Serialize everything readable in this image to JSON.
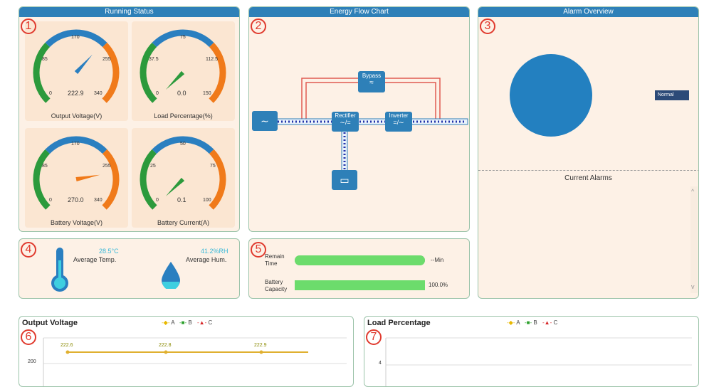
{
  "running_status": {
    "title": "Running Status",
    "badge": "1",
    "gauges": [
      {
        "label": "Output Voltage(V)",
        "value": "222.9",
        "min": "0",
        "tick1": "85",
        "tick2": "170",
        "tick3": "255",
        "max": "340",
        "fraction": 0.656
      },
      {
        "label": "Load Percentage(%)",
        "value": "0.0",
        "min": "0",
        "tick1": "37.5",
        "tick2": "75",
        "tick3": "112.5",
        "max": "150",
        "fraction": 0.0
      },
      {
        "label": "Battery Voltage(V)",
        "value": "270.0",
        "min": "0",
        "tick1": "85",
        "tick2": "170",
        "tick3": "255",
        "max": "340",
        "fraction": 0.794
      },
      {
        "label": "Battery Current(A)",
        "value": "0.1",
        "min": "0",
        "tick1": "25",
        "tick2": "50",
        "tick3": "75",
        "max": "100",
        "fraction": 0.001
      }
    ]
  },
  "energy_flow": {
    "title": "Energy Flow Chart",
    "badge": "2",
    "bypass_label": "Bypass",
    "rectifier_label": "Rectifier",
    "inverter_label": "Inverter"
  },
  "alarm_overview": {
    "title": "Alarm Overview",
    "badge": "3",
    "legend_label": "Normal",
    "current_alarms_title": "Current Alarms"
  },
  "environment": {
    "badge": "4",
    "temp_value": "28.5°C",
    "temp_label": "Average Temp.",
    "hum_value": "41.2%RH",
    "hum_label": "Average Hum."
  },
  "battery": {
    "badge": "5",
    "remain_label": "Remain Time",
    "remain_value": "--Min",
    "remain_fraction": 1.0,
    "capacity_label": "Battery Capacity",
    "capacity_value": "100.0%",
    "capacity_fraction": 1.0
  },
  "output_voltage_chart": {
    "badge": "6",
    "title": "Output Voltage",
    "legend": [
      "A",
      "B",
      "C"
    ],
    "y_ticks": [
      "200"
    ],
    "top_tick": "",
    "point_labels": [
      "222.6",
      "222.8",
      "222.9"
    ]
  },
  "load_percentage_chart": {
    "badge": "7",
    "title": "Load Percentage",
    "legend": [
      "A",
      "B",
      "C"
    ],
    "y_ticks": [
      "4"
    ]
  },
  "colors": {
    "header": "#2e80b8",
    "panel_bg": "#fdf1e6",
    "gauge_green": "#2c9a3c",
    "gauge_blue": "#2a7fc0",
    "gauge_orange": "#f07a1a",
    "needle_voltage": "#2a7fc0",
    "needle_load": "#2c9a3c",
    "needle_batt_v": "#f07a1a",
    "needle_batt_i": "#2c9a3c",
    "bar_green": "#6cdc6c",
    "pie_blue": "#2380c0"
  },
  "chart_data": [
    {
      "type": "line",
      "title": "Output Voltage",
      "series": [
        {
          "name": "A",
          "values": [
            222.6,
            222.8,
            222.9
          ]
        },
        {
          "name": "B",
          "values": []
        },
        {
          "name": "C",
          "values": []
        }
      ]
    },
    {
      "type": "line",
      "title": "Load Percentage",
      "series": [
        {
          "name": "A",
          "values": []
        },
        {
          "name": "B",
          "values": []
        },
        {
          "name": "C",
          "values": []
        }
      ]
    }
  ]
}
